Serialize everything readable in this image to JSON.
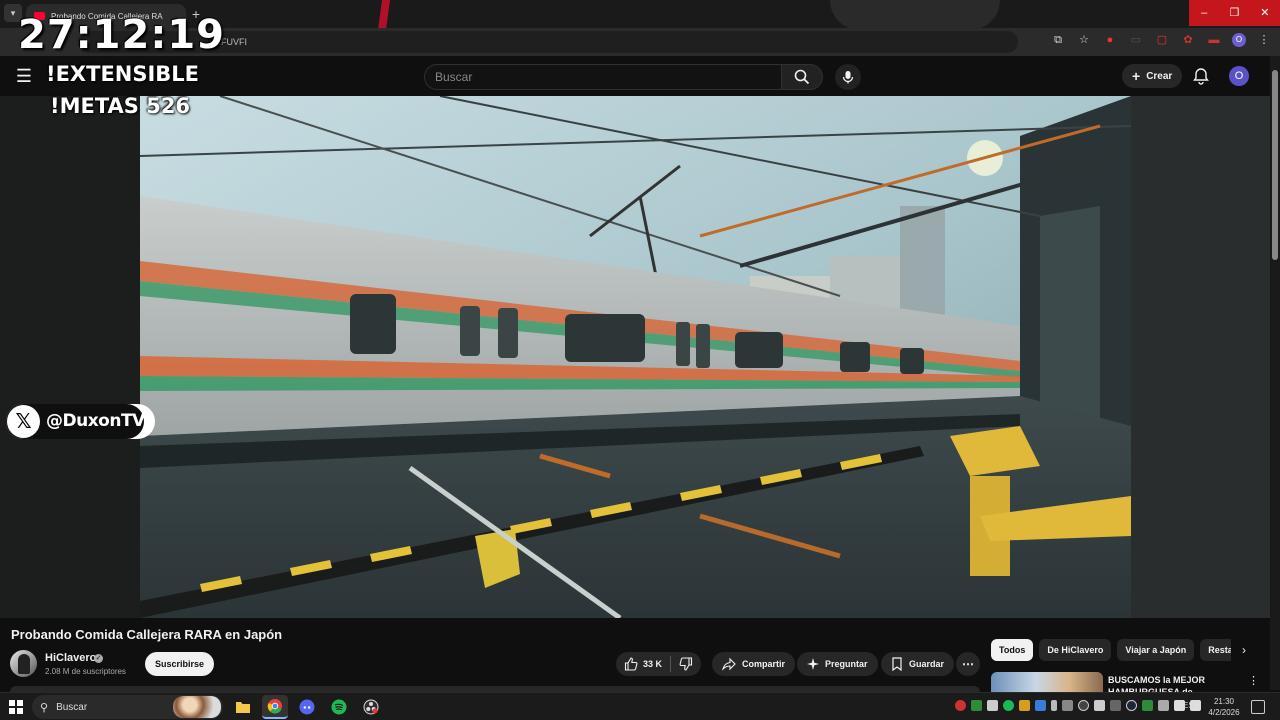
{
  "browser": {
    "tab_title": "Probando Comida Callejera RA",
    "url_fragment": "4EFUVFI",
    "window_controls": [
      "–",
      "❐",
      "✕"
    ]
  },
  "youtube": {
    "search_placeholder": "Buscar",
    "create_label": "Crear",
    "account_initial": "O"
  },
  "stream_overlay": {
    "timer": "27:12:19",
    "line1": "!EXTENSIBLE",
    "line2": "!METAS 526",
    "social_handle": "@DuxonTV"
  },
  "video": {
    "title": "Probando Comida Callejera RARA en Japón",
    "channel_name": "HiClavero",
    "subscribers": "2.08 M de suscriptores",
    "subscribe_label": "Suscribirse",
    "likes": "33 K",
    "share_label": "Compartir",
    "ask_label": "Preguntar",
    "save_label": "Guardar"
  },
  "chips": [
    "Todos",
    "De HiClavero",
    "Viajar a Japón",
    "Resta"
  ],
  "recommendation": {
    "title": "BUSCAMOS la MEJOR HAMBURGUESA de"
  },
  "taskbar": {
    "search_label": "Buscar",
    "language": "ESP",
    "time": "21:30",
    "date": "4/2/2026"
  },
  "colors": {
    "accent_red": "#ff0033",
    "window_close": "#c4161c",
    "avatar": "#5c52c8"
  }
}
